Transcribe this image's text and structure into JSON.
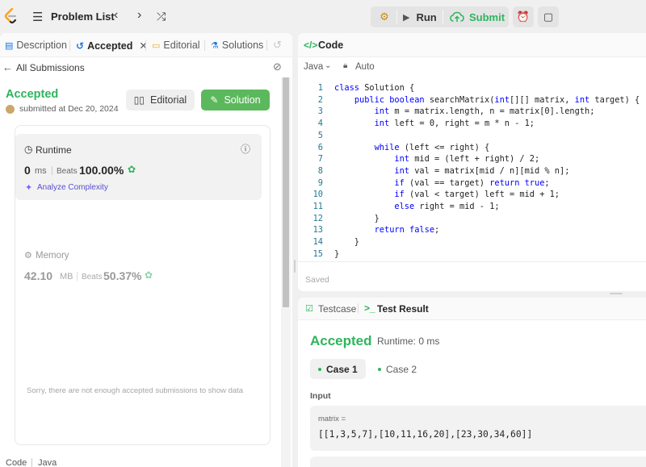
{
  "topbar": {
    "problem_list": "Problem List",
    "run": "Run",
    "submit": "Submit"
  },
  "left_tabs": [
    {
      "label": "Description"
    },
    {
      "label": "Accepted"
    },
    {
      "label": "Editorial"
    },
    {
      "label": "Solutions"
    }
  ],
  "submission": {
    "back_label": "All Submissions",
    "status": "Accepted",
    "submitted_at": "submitted at Dec 20, 2024",
    "editorial_btn": "Editorial",
    "solution_btn": "Solution",
    "runtime_label": "Runtime",
    "runtime_value": "0",
    "runtime_unit": "ms",
    "runtime_beats_label": "Beats",
    "runtime_beats": "100.00%",
    "analyze": "Analyze Complexity",
    "memory_label": "Memory",
    "memory_value": "42.10",
    "memory_unit": "MB",
    "memory_beats_label": "Beats",
    "memory_beats": "50.37%",
    "no_data": "Sorry, there are not enough accepted submissions to show data",
    "footer_code": "Code",
    "footer_lang": "Java"
  },
  "code": {
    "header": "Code",
    "language": "Java",
    "format": "Auto",
    "saved": "Saved",
    "lines": [
      "class Solution {",
      "    public boolean searchMatrix(int[][] matrix, int target) {",
      "        int m = matrix.length, n = matrix[0].length;",
      "        int left = 0, right = m * n - 1;",
      "",
      "        while (left <= right) {",
      "            int mid = (left + right) / 2;",
      "            int val = matrix[mid / n][mid % n];",
      "            if (val == target) return true;",
      "            if (val < target) left = mid + 1;",
      "            else right = mid - 1;",
      "        }",
      "        return false;",
      "    }",
      "}"
    ]
  },
  "test": {
    "tab_testcase": "Testcase",
    "tab_result": "Test Result",
    "status": "Accepted",
    "runtime": "Runtime: 0 ms",
    "case1": "Case 1",
    "case2": "Case 2",
    "input_label": "Input",
    "param_name": "matrix =",
    "param_value": "[[1,3,5,7],[10,11,16,20],[23,30,34,60]]"
  },
  "colors": {
    "accent_green": "#2db55d",
    "solution_green": "#5cb85c",
    "tab_blue": "#1a73e8",
    "editorial_orange": "#f5a623"
  }
}
